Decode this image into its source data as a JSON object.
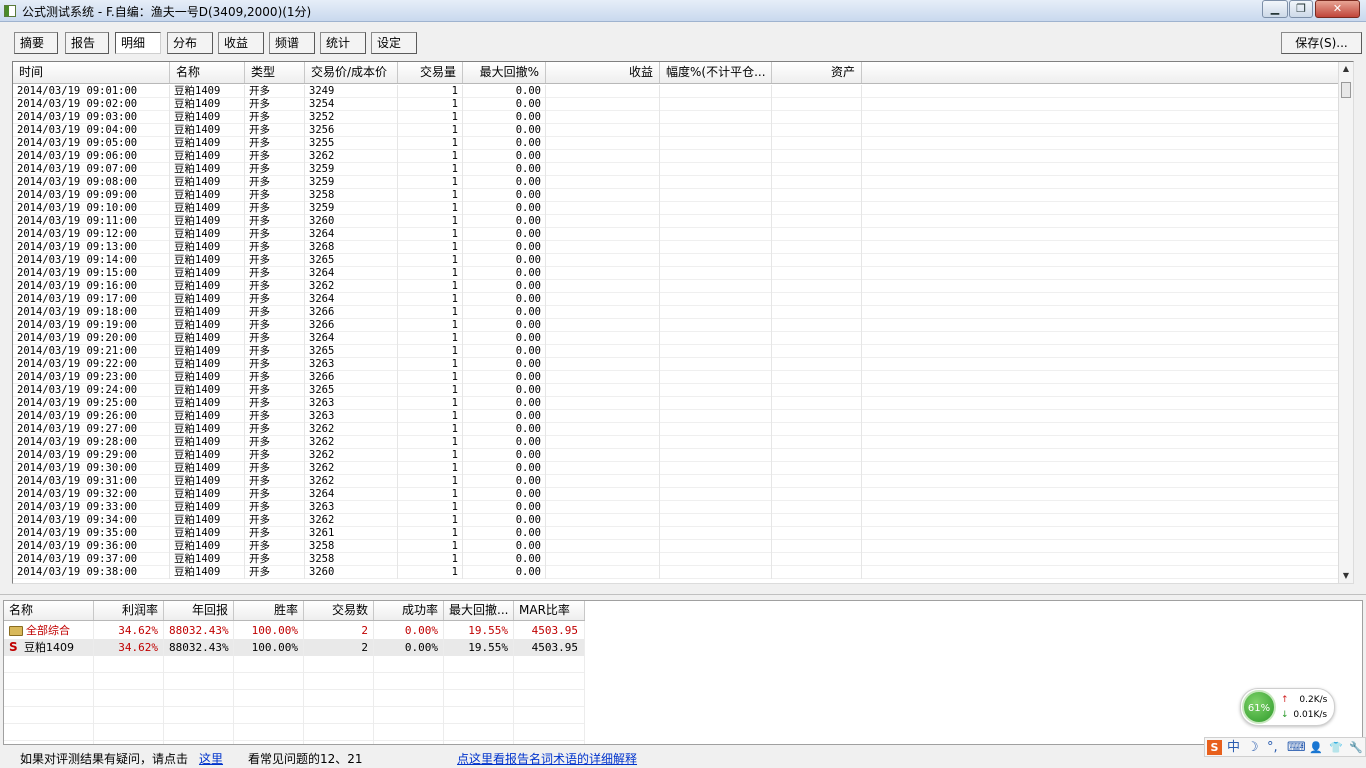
{
  "window": {
    "title": "公式测试系统 - F.自编：渔夫一号D(3409,2000)(1分)",
    "minimize_glyph": "▁",
    "restore_glyph": "❐",
    "close_glyph": "✕"
  },
  "toolbar": {
    "tabs": [
      "摘要",
      "报告",
      "明细",
      "分布",
      "收益",
      "频谱",
      "统计",
      "设定"
    ],
    "active": "明细",
    "save_label": "保存(S)..."
  },
  "detail_table": {
    "columns": [
      "时间",
      "名称",
      "类型",
      "交易价/成本价",
      "交易量",
      "最大回撤%",
      "收益",
      "幅度%(不计平仓...",
      "资产"
    ],
    "rows": [
      [
        "2014/03/19 09:01:00",
        "豆粕1409",
        "开多",
        "3249",
        "1",
        "0.00"
      ],
      [
        "2014/03/19 09:02:00",
        "豆粕1409",
        "开多",
        "3254",
        "1",
        "0.00"
      ],
      [
        "2014/03/19 09:03:00",
        "豆粕1409",
        "开多",
        "3252",
        "1",
        "0.00"
      ],
      [
        "2014/03/19 09:04:00",
        "豆粕1409",
        "开多",
        "3256",
        "1",
        "0.00"
      ],
      [
        "2014/03/19 09:05:00",
        "豆粕1409",
        "开多",
        "3255",
        "1",
        "0.00"
      ],
      [
        "2014/03/19 09:06:00",
        "豆粕1409",
        "开多",
        "3262",
        "1",
        "0.00"
      ],
      [
        "2014/03/19 09:07:00",
        "豆粕1409",
        "开多",
        "3259",
        "1",
        "0.00"
      ],
      [
        "2014/03/19 09:08:00",
        "豆粕1409",
        "开多",
        "3259",
        "1",
        "0.00"
      ],
      [
        "2014/03/19 09:09:00",
        "豆粕1409",
        "开多",
        "3258",
        "1",
        "0.00"
      ],
      [
        "2014/03/19 09:10:00",
        "豆粕1409",
        "开多",
        "3259",
        "1",
        "0.00"
      ],
      [
        "2014/03/19 09:11:00",
        "豆粕1409",
        "开多",
        "3260",
        "1",
        "0.00"
      ],
      [
        "2014/03/19 09:12:00",
        "豆粕1409",
        "开多",
        "3264",
        "1",
        "0.00"
      ],
      [
        "2014/03/19 09:13:00",
        "豆粕1409",
        "开多",
        "3268",
        "1",
        "0.00"
      ],
      [
        "2014/03/19 09:14:00",
        "豆粕1409",
        "开多",
        "3265",
        "1",
        "0.00"
      ],
      [
        "2014/03/19 09:15:00",
        "豆粕1409",
        "开多",
        "3264",
        "1",
        "0.00"
      ],
      [
        "2014/03/19 09:16:00",
        "豆粕1409",
        "开多",
        "3262",
        "1",
        "0.00"
      ],
      [
        "2014/03/19 09:17:00",
        "豆粕1409",
        "开多",
        "3264",
        "1",
        "0.00"
      ],
      [
        "2014/03/19 09:18:00",
        "豆粕1409",
        "开多",
        "3266",
        "1",
        "0.00"
      ],
      [
        "2014/03/19 09:19:00",
        "豆粕1409",
        "开多",
        "3266",
        "1",
        "0.00"
      ],
      [
        "2014/03/19 09:20:00",
        "豆粕1409",
        "开多",
        "3264",
        "1",
        "0.00"
      ],
      [
        "2014/03/19 09:21:00",
        "豆粕1409",
        "开多",
        "3265",
        "1",
        "0.00"
      ],
      [
        "2014/03/19 09:22:00",
        "豆粕1409",
        "开多",
        "3263",
        "1",
        "0.00"
      ],
      [
        "2014/03/19 09:23:00",
        "豆粕1409",
        "开多",
        "3266",
        "1",
        "0.00"
      ],
      [
        "2014/03/19 09:24:00",
        "豆粕1409",
        "开多",
        "3265",
        "1",
        "0.00"
      ],
      [
        "2014/03/19 09:25:00",
        "豆粕1409",
        "开多",
        "3263",
        "1",
        "0.00"
      ],
      [
        "2014/03/19 09:26:00",
        "豆粕1409",
        "开多",
        "3263",
        "1",
        "0.00"
      ],
      [
        "2014/03/19 09:27:00",
        "豆粕1409",
        "开多",
        "3262",
        "1",
        "0.00"
      ],
      [
        "2014/03/19 09:28:00",
        "豆粕1409",
        "开多",
        "3262",
        "1",
        "0.00"
      ],
      [
        "2014/03/19 09:29:00",
        "豆粕1409",
        "开多",
        "3262",
        "1",
        "0.00"
      ],
      [
        "2014/03/19 09:30:00",
        "豆粕1409",
        "开多",
        "3262",
        "1",
        "0.00"
      ],
      [
        "2014/03/19 09:31:00",
        "豆粕1409",
        "开多",
        "3262",
        "1",
        "0.00"
      ],
      [
        "2014/03/19 09:32:00",
        "豆粕1409",
        "开多",
        "3264",
        "1",
        "0.00"
      ],
      [
        "2014/03/19 09:33:00",
        "豆粕1409",
        "开多",
        "3263",
        "1",
        "0.00"
      ],
      [
        "2014/03/19 09:34:00",
        "豆粕1409",
        "开多",
        "3262",
        "1",
        "0.00"
      ],
      [
        "2014/03/19 09:35:00",
        "豆粕1409",
        "开多",
        "3261",
        "1",
        "0.00"
      ],
      [
        "2014/03/19 09:36:00",
        "豆粕1409",
        "开多",
        "3258",
        "1",
        "0.00"
      ],
      [
        "2014/03/19 09:37:00",
        "豆粕1409",
        "开多",
        "3258",
        "1",
        "0.00"
      ],
      [
        "2014/03/19 09:38:00",
        "豆粕1409",
        "开多",
        "3260",
        "1",
        "0.00"
      ]
    ]
  },
  "summary_table": {
    "columns": [
      "名称",
      "利润率",
      "年回报",
      "胜率",
      "交易数",
      "成功率",
      "最大回撤...",
      "MAR比率"
    ],
    "rows": [
      {
        "icon": "folder-icon",
        "name": "全部综合",
        "values": [
          "34.62%",
          "88032.43%",
          "100.00%",
          "2",
          "0.00%",
          "19.55%",
          "4503.95"
        ]
      },
      {
        "icon": "s-icon",
        "name": "豆粕1409",
        "values": [
          "34.62%",
          "88032.43%",
          "100.00%",
          "2",
          "0.00%",
          "19.55%",
          "4503.95"
        ]
      }
    ],
    "s_glyph": "S"
  },
  "footer": {
    "question_text": "如果对评测结果有疑问，请点击",
    "link_here": "这里",
    "faq_text": "看常见问题的12、21",
    "terms_link": "点这里看报告名词术语的详细解释"
  },
  "network_widget": {
    "percent": "61%",
    "up_speed": "0.2K/s",
    "down_speed": "0.01K/s",
    "up_glyph": "↑",
    "down_glyph": "↓"
  },
  "ime_bar": {
    "items": [
      "S",
      "中",
      "☽",
      "°,",
      "⌨",
      "👤",
      "👕",
      "🔧"
    ]
  },
  "colors": {
    "accent_red": "#c00000",
    "link_blue": "#0033cc",
    "titlebar": "#c9d9ee"
  }
}
